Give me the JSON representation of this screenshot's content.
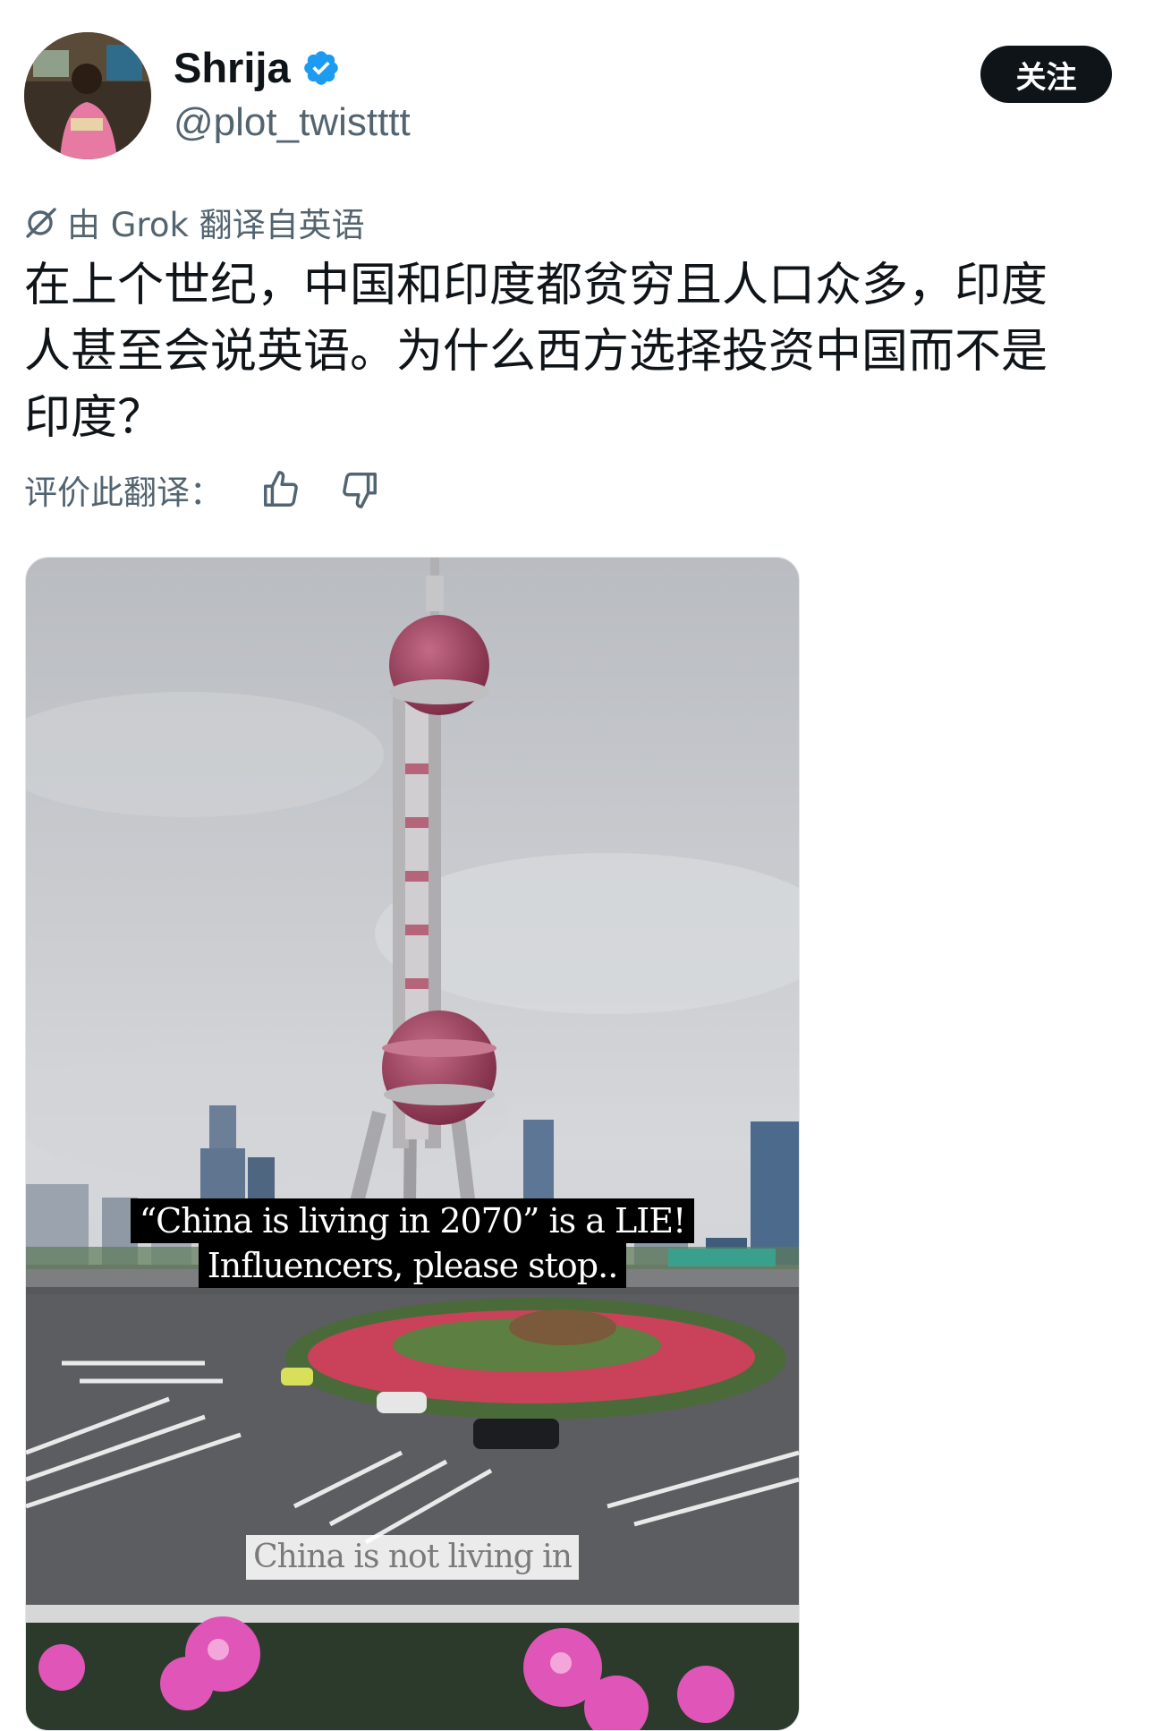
{
  "user": {
    "display_name": "Shrija",
    "handle": "@plot_twistttt",
    "verified": true,
    "avatar_icon": "user-avatar"
  },
  "actions": {
    "follow_label": "关注"
  },
  "translation": {
    "note": "由 Grok 翻译自英语",
    "icon": "translate-icon",
    "rate_label": "评价此翻译："
  },
  "tweet": {
    "lines": [
      "在上个世纪，中国和印度都贫穷且人口众多，印度",
      "人甚至会说英语。为什么西方选择投资中国而不是",
      "印度？"
    ]
  },
  "media": {
    "caption_line1": "“China is living in 2070” is a LIE!",
    "caption_line2": "Influencers, please stop..",
    "caption_bottom": "China is not living in"
  },
  "colors": {
    "text_primary": "#0f1419",
    "text_secondary": "#536471",
    "verified_blue": "#1d9bf0",
    "button_bg": "#0f1419"
  }
}
